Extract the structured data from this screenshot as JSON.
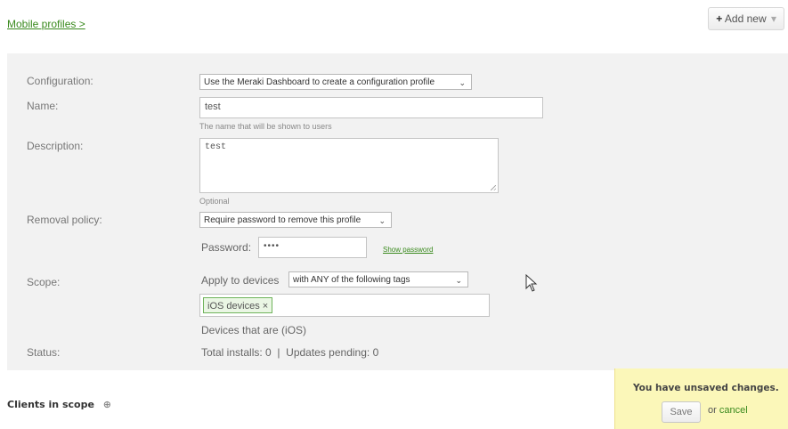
{
  "breadcrumb": {
    "label": "Mobile profiles >"
  },
  "header": {
    "add_new_label": "Add new",
    "add_new_plus": "+",
    "add_new_chevron": "▾"
  },
  "form": {
    "configuration": {
      "label": "Configuration:",
      "selected": "Use the Meraki Dashboard to create a configuration profile"
    },
    "name": {
      "label": "Name:",
      "value": "test",
      "hint": "The name that will be shown to users"
    },
    "description": {
      "label": "Description:",
      "value": "test",
      "hint": "Optional"
    },
    "removal_policy": {
      "label": "Removal policy:",
      "selected": "Require password to remove this profile",
      "password_label": "Password:",
      "password_value": "••••",
      "show_password_label": "Show password"
    },
    "scope": {
      "label": "Scope:",
      "apply_label": "Apply to devices",
      "selected": "with ANY of the following tags",
      "tag": "iOS devices",
      "tag_remove": "×",
      "devices_note": "Devices that are (iOS)"
    },
    "status": {
      "label": "Status:",
      "value": "Total installs: 0  |  Updates pending: 0"
    }
  },
  "clients": {
    "title": "Clients in scope",
    "info_icon": "⊕"
  },
  "unsaved_bar": {
    "message": "You have unsaved changes.",
    "save_label": "Save",
    "or_label": "or",
    "cancel_label": "cancel"
  },
  "colors": {
    "link": "#3a8a1e",
    "panel_bg": "#f2f2f2",
    "unsaved_bg": "#fbf7b9",
    "tag_border": "#6fb35a"
  },
  "icons": {
    "dropdown": "chevron-down-icon",
    "cursor": "mouse-pointer-icon"
  }
}
